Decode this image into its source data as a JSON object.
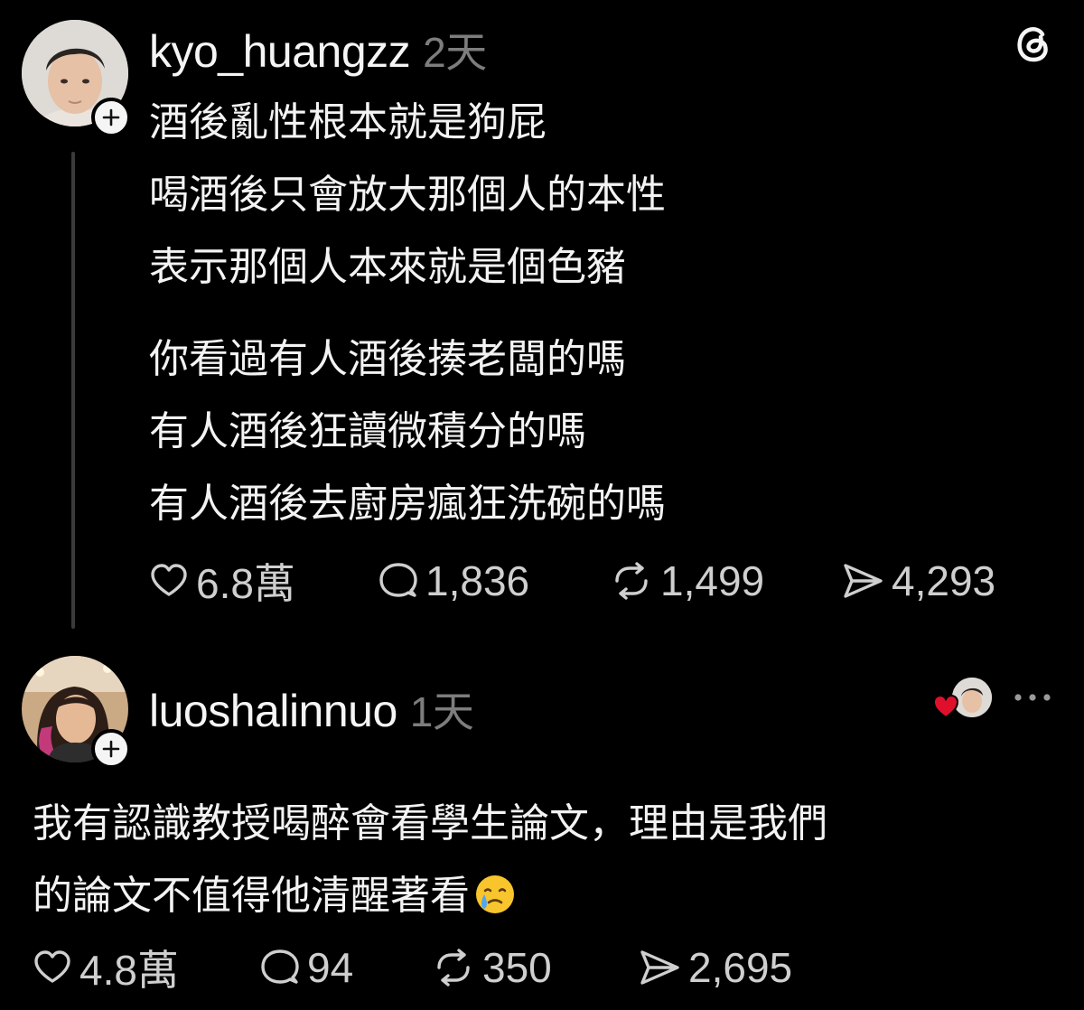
{
  "post": {
    "username": "kyo_huangzz",
    "time": "2天",
    "lines_block1": [
      "酒後亂性根本就是狗屁",
      "喝酒後只會放大那個人的本性",
      "表示那個人本來就是個色豬"
    ],
    "lines_block2": [
      "你看過有人酒後揍老闆的嗎",
      "有人酒後狂讀微積分的嗎",
      "有人酒後去廚房瘋狂洗碗的嗎"
    ],
    "likes": "6.8萬",
    "comments": "1,836",
    "reposts": "1,499",
    "shares": "4,293"
  },
  "reply": {
    "username": "luoshalinnuo",
    "time": "1天",
    "lines": [
      "我有認識教授喝醉會看學生論文，理由是我們",
      "的論文不值得他清醒著看"
    ],
    "likes": "4.8萬",
    "comments": "94",
    "reposts": "350",
    "shares": "2,695"
  },
  "icons": {
    "app_logo": "threads-logo-icon",
    "like": "heart-icon",
    "comment": "comment-bubble-icon",
    "repost": "repost-icon",
    "share": "send-icon",
    "more": "more-dots-icon",
    "follow": "plus-icon",
    "liked_by_author": "red-heart-icon",
    "emoji": "crying-face-emoji"
  },
  "colors": {
    "background": "#000000",
    "text": "#f3f3f3",
    "secondary": "#7d7d7d",
    "liked_heart": "#e0102c"
  }
}
